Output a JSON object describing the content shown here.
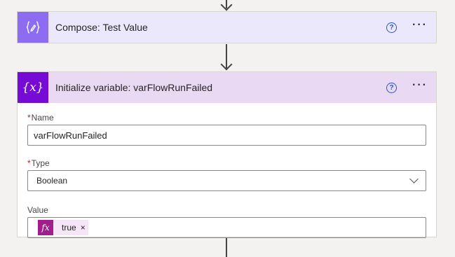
{
  "compose_card": {
    "title": "Compose: Test Value",
    "icon": "pencil-braces-icon",
    "help_glyph": "?",
    "more_glyph": "···"
  },
  "init_var_card": {
    "title": "Initialize variable: varFlowRunFailed",
    "icon": "variable-x-icon",
    "help_glyph": "?",
    "more_glyph": "···",
    "name_label": "Name",
    "name_value": "varFlowRunFailed",
    "type_label": "Type",
    "type_value": "Boolean",
    "value_label": "Value",
    "token_glyph": "fx",
    "token_text": "true",
    "token_remove": "×",
    "required_marker": "*"
  },
  "colors": {
    "compose_icon_bg": "#8c6cf1",
    "compose_header_bg": "#ece8fb",
    "var_icon_bg": "#770bd6",
    "var_header_bg": "#ead9f2",
    "expression_token": "#a11d8d",
    "help_blue": "#2456c8"
  }
}
